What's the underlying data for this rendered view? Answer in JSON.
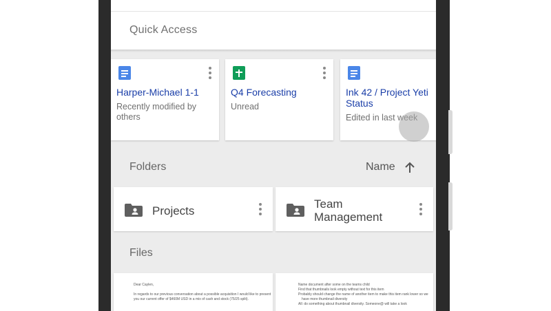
{
  "quick_access": {
    "title": "Quick Access",
    "cards": [
      {
        "icon": "google-docs-icon",
        "title": "Harper-Michael 1-1",
        "subtitle": "Recently modified by others"
      },
      {
        "icon": "google-sheets-icon",
        "title": "Q4 Forecasting",
        "subtitle": "Unread"
      },
      {
        "icon": "google-docs-icon",
        "title": "Ink 42 / Project Yeti Status",
        "subtitle": "Edited in last week"
      }
    ]
  },
  "folders": {
    "title": "Folders",
    "sort_label": "Name",
    "sort_icon": "arrow-up-icon",
    "items": [
      {
        "icon": "shared-folder-icon",
        "name": "Projects"
      },
      {
        "icon": "shared-folder-icon",
        "name": "Team Management"
      }
    ]
  },
  "files": {
    "title": "Files",
    "thumbnails": [
      {
        "lines": [
          "Dear Caylen,",
          "In regards to our previous conversation about a possible acquisition I would like to present",
          "you our current offer of $460M USD in a mix of cash and stock (75/25 split)."
        ]
      },
      {
        "lines": [
          "Name document after some on the teams child",
          "Find that thumbnails look empty without text for this item",
          "Probably should change the name of another item to make this item rank lower so we",
          "have more thumbnail diversity",
          "All: do something about thumbnail diversity. Someone@ will take a look"
        ]
      }
    ]
  },
  "colors": {
    "docs_blue": "#4a86e8",
    "sheets_green": "#0f9d58",
    "title_blue": "#1a3ea8"
  }
}
